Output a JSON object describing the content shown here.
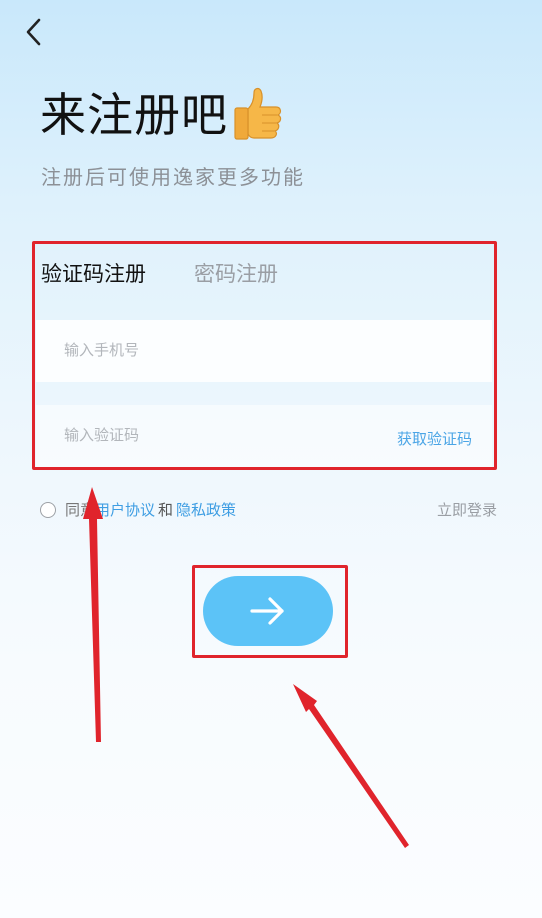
{
  "header": {
    "back_icon": "chevron-left-icon"
  },
  "title": {
    "text": "来注册吧",
    "emoji_icon": "thumbs-up-icon"
  },
  "subtitle": "注册后可使用逸家更多功能",
  "tabs": [
    {
      "label": "验证码注册",
      "active": true
    },
    {
      "label": "密码注册",
      "active": false
    }
  ],
  "form": {
    "phone_placeholder": "输入手机号",
    "code_placeholder": "输入验证码",
    "get_code_label": "获取验证码"
  },
  "agreement": {
    "prefix": "同意",
    "user_agreement": "用户协议",
    "and": "和",
    "privacy_policy": "隐私政策"
  },
  "login_link": "立即登录",
  "submit_icon": "arrow-right-icon",
  "colors": {
    "accent": "#5cc3f7",
    "link": "#3f9ee3",
    "highlight": "#e0242c"
  }
}
